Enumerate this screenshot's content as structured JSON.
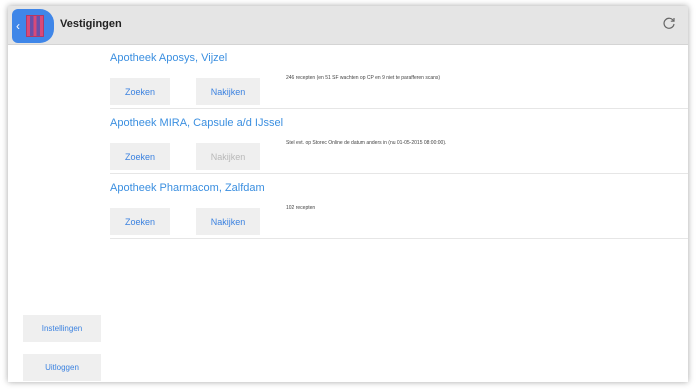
{
  "header": {
    "title": "Vestigingen",
    "back_icon": "chevron-left-icon",
    "refresh_icon": "refresh-icon"
  },
  "locations": [
    {
      "name": "Apotheek Aposys, Vijzel",
      "search_label": "Zoeken",
      "check_label": "Nakijken",
      "check_enabled": true,
      "info": "246 recepten (en 51 SF wachten op CP en 9 niet te parafferen scans)"
    },
    {
      "name": "Apotheek MIRA, Capsule a/d IJssel",
      "search_label": "Zoeken",
      "check_label": "Nakijken",
      "check_enabled": false,
      "info": "Stel evt. op Storec Online de datum anders in (nu 01-05-2015 08:00:00)."
    },
    {
      "name": "Apotheek Pharmacom, Zalfdam",
      "search_label": "Zoeken",
      "check_label": "Nakijken",
      "check_enabled": true,
      "info": "102 recepten"
    }
  ],
  "sidebar": {
    "settings_label": "Instellingen",
    "logout_label": "Uitloggen"
  },
  "colors": {
    "accent": "#3b82e0",
    "header_bg": "#e5e5e5",
    "button_bg": "#efefef"
  }
}
